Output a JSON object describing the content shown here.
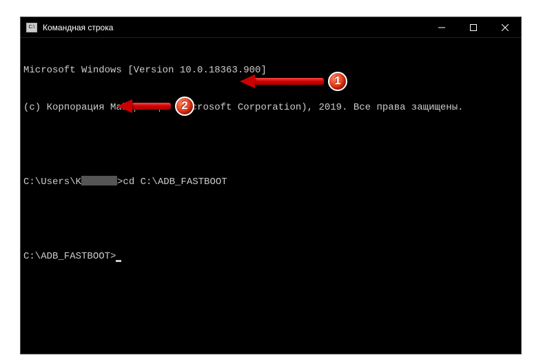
{
  "window": {
    "title": "Командная строка"
  },
  "terminal": {
    "line1": "Microsoft Windows [Version 10.0.18363.900]",
    "line2": "(c) Корпорация Майкрософт (Microsoft Corporation), 2019. Все права защищены.",
    "prompt1_prefix": "C:\\Users\\K",
    "prompt1_suffix": ">",
    "command1": "cd C:\\ADB_FASTBOOT",
    "prompt2": "C:\\ADB_FASTBOOT>"
  },
  "annotations": {
    "step1": "1",
    "step2": "2"
  }
}
